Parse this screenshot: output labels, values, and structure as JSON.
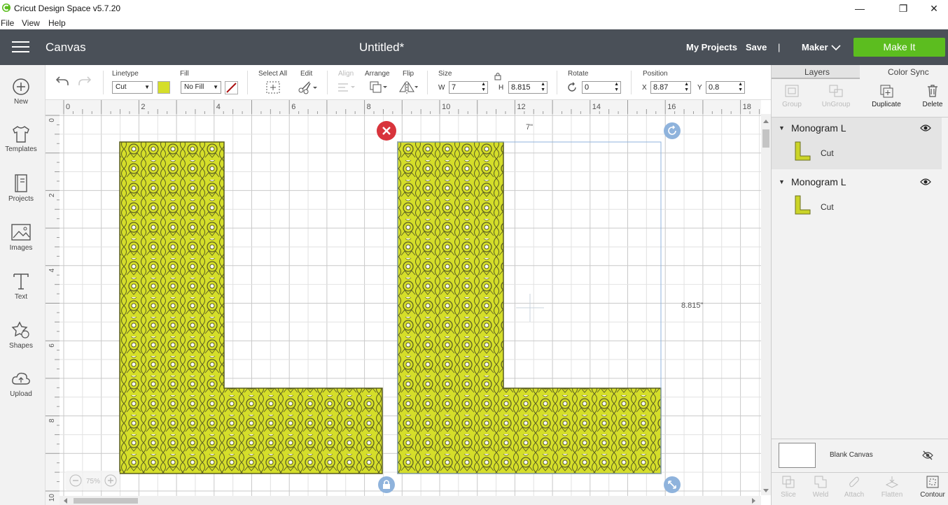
{
  "window": {
    "title": "Cricut Design Space  v5.7.20",
    "controls": {
      "minimize": "—",
      "restore": "❐",
      "close": "✕"
    }
  },
  "menu": {
    "items": [
      "File",
      "View",
      "Help"
    ]
  },
  "header": {
    "section": "Canvas",
    "document_title": "Untitled*",
    "my_projects": "My Projects",
    "save": "Save",
    "separator": "|",
    "machine": "Maker",
    "make_it": "Make It",
    "make_it_color": "#5cbd1f"
  },
  "left_nav": {
    "items": [
      {
        "label": "New",
        "icon": "plus-circle-icon"
      },
      {
        "label": "Templates",
        "icon": "shirt-icon"
      },
      {
        "label": "Projects",
        "icon": "book-icon"
      },
      {
        "label": "Images",
        "icon": "image-icon"
      },
      {
        "label": "Text",
        "icon": "text-icon"
      },
      {
        "label": "Shapes",
        "icon": "shapes-icon"
      },
      {
        "label": "Upload",
        "icon": "cloud-upload-icon"
      }
    ]
  },
  "toolbar": {
    "linetype_label": "Linetype",
    "linetype_value": "Cut",
    "linetype_color": "#d5de2a",
    "fill_label": "Fill",
    "fill_value": "No Fill",
    "select_all_label": "Select All",
    "edit_label": "Edit",
    "align_label": "Align",
    "arrange_label": "Arrange",
    "flip_label": "Flip",
    "size_label": "Size",
    "w_label": "W",
    "w_value": "7",
    "h_label": "H",
    "h_value": "8.815",
    "rotate_label": "Rotate",
    "rotate_value": "0",
    "position_label": "Position",
    "x_label": "X",
    "x_value": "8.87",
    "y_label": "Y",
    "y_value": "0.8"
  },
  "canvas": {
    "ruler_x": [
      "0",
      "2",
      "4",
      "6",
      "8",
      "10",
      "12",
      "14",
      "16",
      "18"
    ],
    "ruler_y": [
      "0",
      "2",
      "4",
      "6",
      "8",
      "10"
    ],
    "width_readout": "7\"",
    "height_readout": "8.815\"",
    "zoom": "75%",
    "object_color": "#d5de2a",
    "selection_color": "#8fb3dc"
  },
  "right_panel": {
    "tabs": [
      "Layers",
      "Color Sync"
    ],
    "actions": [
      {
        "label": "Group",
        "enabled": false
      },
      {
        "label": "UnGroup",
        "enabled": false
      },
      {
        "label": "Duplicate",
        "enabled": true
      },
      {
        "label": "Delete",
        "enabled": true
      }
    ],
    "layers": [
      {
        "name": "Monogram L",
        "sub": "Cut"
      },
      {
        "name": "Monogram L",
        "sub": "Cut"
      }
    ],
    "blank_canvas": "Blank Canvas",
    "bottom_actions": [
      "Slice",
      "Weld",
      "Attach",
      "Flatten",
      "Contour"
    ]
  }
}
